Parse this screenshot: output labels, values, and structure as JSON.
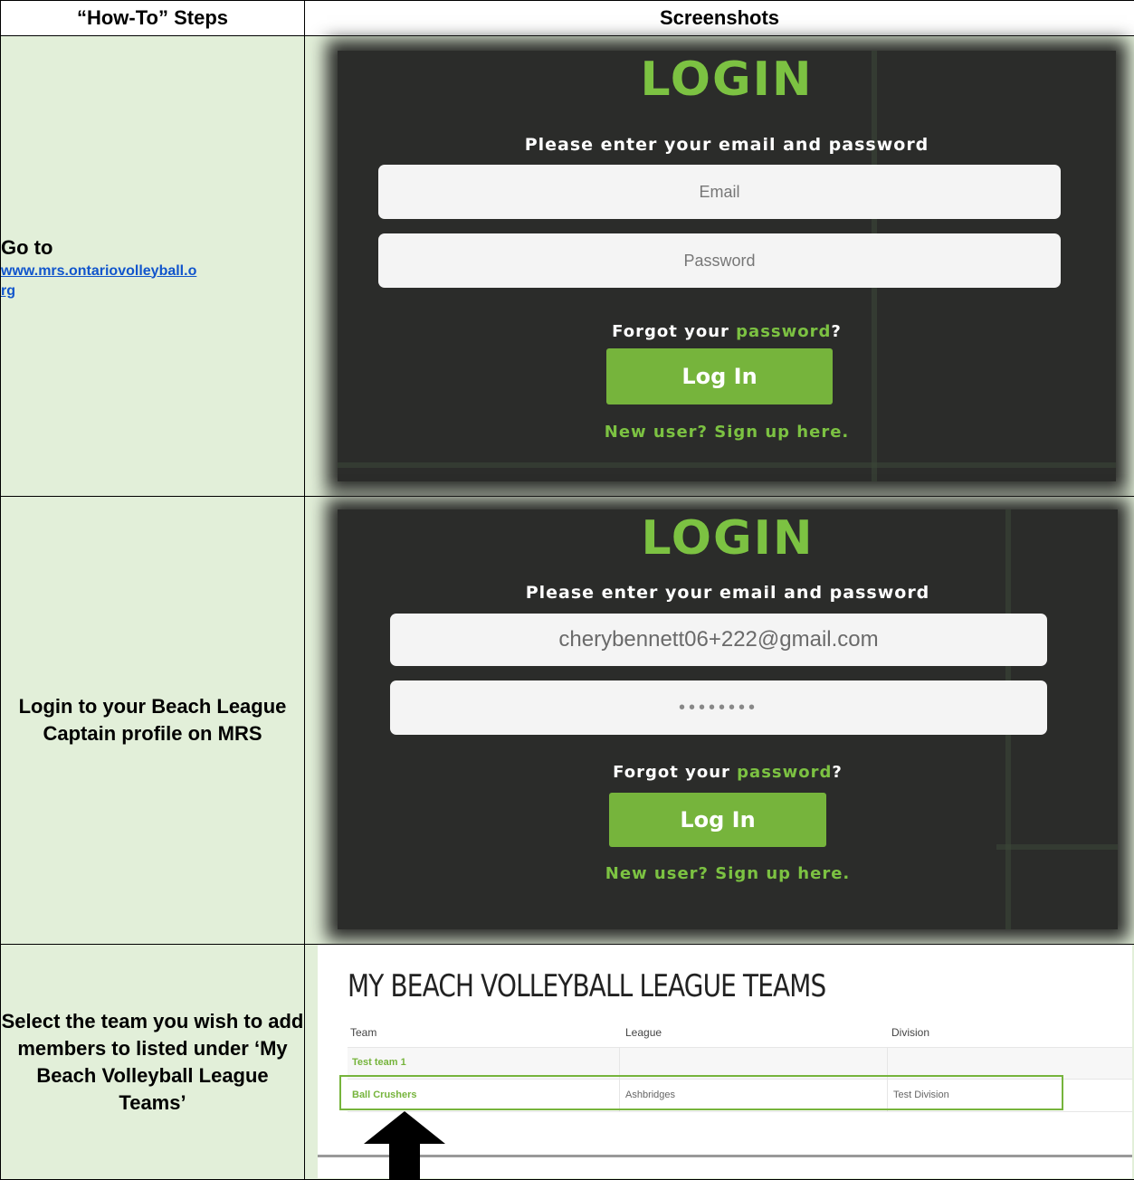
{
  "table": {
    "header_steps": "“How-To” Steps",
    "header_screenshots": "Screenshots"
  },
  "steps": [
    {
      "prefix": "Go to",
      "link": "www.mrs.ontariovolleyball.org",
      "link_part1": "www.mrs.ontariovolleyball.o",
      "link_part2": "rg"
    },
    {
      "text": "Login to your Beach League Captain profile on MRS"
    },
    {
      "text": "Select the team you wish to add members to listed under ‘My Beach Volleyball League Teams’"
    }
  ],
  "login_empty": {
    "title": "LOGIN",
    "subtitle": "Please enter your email and password",
    "email_placeholder": "Email",
    "password_placeholder": "Password",
    "forgot_prefix": "Forgot your ",
    "forgot_link": "password",
    "forgot_suffix": "?",
    "login_button": "Log In",
    "signup": "New user? Sign up here."
  },
  "login_filled": {
    "title": "LOGIN",
    "subtitle": "Please enter your email and password",
    "email_value": "cherybennett06+222@gmail.com",
    "password_value": "••••••••",
    "forgot_prefix": "Forgot your ",
    "forgot_link": "password",
    "forgot_suffix": "?",
    "login_button": "Log In",
    "signup": "New user? Sign up here."
  },
  "teams": {
    "heading": "MY BEACH VOLLEYBALL LEAGUE TEAMS",
    "columns": [
      "Team",
      "League",
      "Division"
    ],
    "rows": [
      {
        "team": "Test team 1",
        "league": "",
        "division": ""
      },
      {
        "team": "Ball Crushers",
        "league": "Ashbridges",
        "division": "Test Division"
      }
    ]
  },
  "colors": {
    "accent_green": "#7cc242",
    "button_green": "#76b43c",
    "cell_background": "#e2efd9",
    "link_blue": "#1155cc"
  }
}
